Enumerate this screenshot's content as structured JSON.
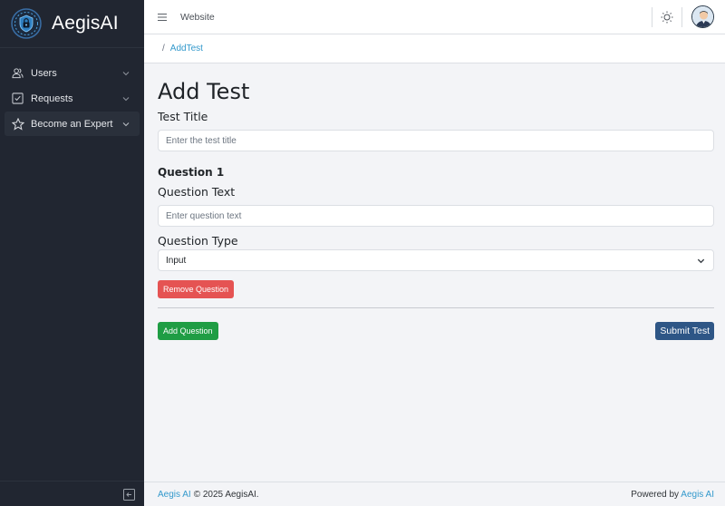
{
  "sidebar": {
    "brand_name": "AegisAI",
    "items": [
      {
        "label": "Users",
        "icon": "users-icon"
      },
      {
        "label": "Requests",
        "icon": "checklist-icon"
      },
      {
        "label": "Become an Expert",
        "icon": "star-icon"
      }
    ]
  },
  "header": {
    "link": "Website"
  },
  "breadcrumb": {
    "separator": "/",
    "current": "AddTest"
  },
  "form": {
    "page_title": "Add Test",
    "test_title_label": "Test Title",
    "test_title_placeholder": "Enter the test title",
    "question_heading": "Question 1",
    "question_text_label": "Question Text",
    "question_text_placeholder": "Enter question text",
    "question_type_label": "Question Type",
    "question_type_value": "Input",
    "remove_question_label": "Remove Question",
    "add_question_label": "Add Question",
    "submit_label": "Submit Test"
  },
  "footer": {
    "left_link": "Aegis AI",
    "left_text": "© 2025 AegisAI.",
    "right_text": "Powered by",
    "right_link": "Aegis AI"
  },
  "colors": {
    "sidebar_bg": "#212631",
    "accent_link": "#3399cc",
    "danger": "#e55353",
    "success": "#1f9d44",
    "primary": "#2e5686"
  }
}
